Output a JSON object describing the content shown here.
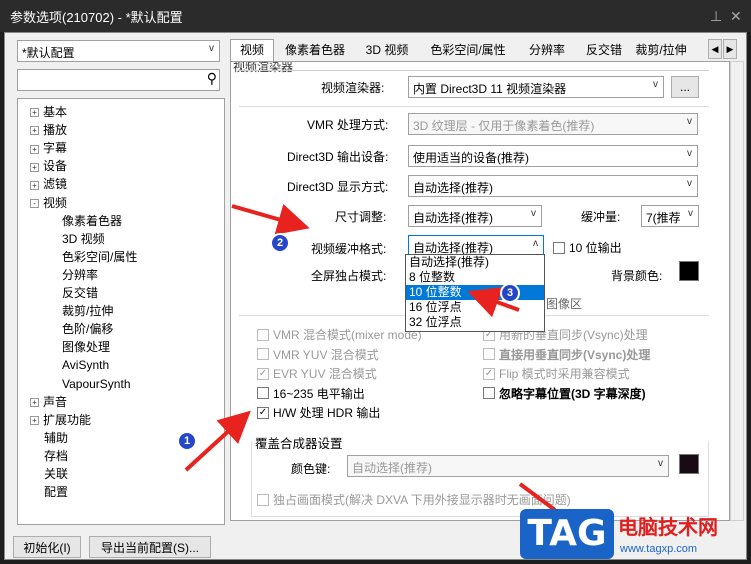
{
  "window": {
    "title": "参数选项(210702) - *默认配置",
    "pin_icon": "pin-icon",
    "close_icon": "close-icon"
  },
  "profile": {
    "selected": "*默认配置"
  },
  "search": {
    "value": ""
  },
  "tree": [
    {
      "label": "基本",
      "expand": "+"
    },
    {
      "label": "播放",
      "expand": "+"
    },
    {
      "label": "字幕",
      "expand": "+"
    },
    {
      "label": "设备",
      "expand": "+"
    },
    {
      "label": "滤镜",
      "expand": "+"
    },
    {
      "label": "视频",
      "expand": "-"
    },
    {
      "label": "像素着色器"
    },
    {
      "label": "3D 视频"
    },
    {
      "label": "色彩空间/属性"
    },
    {
      "label": "分辨率"
    },
    {
      "label": "反交错"
    },
    {
      "label": "裁剪/拉伸"
    },
    {
      "label": "色阶/偏移"
    },
    {
      "label": "图像处理"
    },
    {
      "label": "AviSynth"
    },
    {
      "label": "VapourSynth"
    },
    {
      "label": "声音",
      "expand": "+"
    },
    {
      "label": "扩展功能",
      "expand": "+"
    },
    {
      "label": "辅助"
    },
    {
      "label": "存档"
    },
    {
      "label": "关联"
    },
    {
      "label": "配置"
    }
  ],
  "tabs": [
    "视频",
    "像素着色器",
    "3D 视频",
    "色彩空间/属性",
    "分辨率",
    "反交错",
    "裁剪/拉伸"
  ],
  "panel": {
    "group_title": "视频渲染器",
    "renderer_label": "视频渲染器:",
    "renderer_value": "内置 Direct3D 11 视频渲染器",
    "renderer_more": "...",
    "vmr_label": "VMR 处理方式:",
    "vmr_value": "3D 纹理层 - 仅用于像素着色(推荐)",
    "d3d_device_label": "Direct3D 输出设备:",
    "d3d_device_value": "使用适当的设备(推荐)",
    "d3d_mode_label": "Direct3D 显示方式:",
    "d3d_mode_value": "自动选择(推荐)",
    "resize_label": "尺寸调整:",
    "resize_value": "自动选择(推荐)",
    "buffer_label": "缓冲量:",
    "buffer_value": "7(推荐",
    "bufferfmt_label": "视频缓冲格式:",
    "bufferfmt_value": "自动选择(推荐)",
    "tenbit_label": "10 位输出",
    "fullscreen_label": "全屏独占模式:",
    "bgcolor_label": "背景颜色:",
    "bgcolor": "#000000",
    "hidden_tail": "图像区",
    "dropdown": [
      "自动选择(推荐)",
      "8 位整数",
      "10 位整数",
      "16 位浮点",
      "32 位浮点"
    ],
    "dropdown_selected": 2,
    "checks_left": [
      {
        "label": "VMR 混合模式(mixer mode)",
        "checked": false,
        "disabled": true
      },
      {
        "label": "VMR YUV 混合模式",
        "checked": false,
        "disabled": true
      },
      {
        "label": "EVR YUV 混合模式",
        "checked": true,
        "disabled": true
      },
      {
        "label": "16~235 电平输出",
        "checked": false,
        "disabled": false
      },
      {
        "label": "H/W 处理 HDR 输出",
        "checked": true,
        "disabled": false
      }
    ],
    "checks_right": [
      {
        "label": "用新的垂直同步(Vsync)处理",
        "checked": true,
        "disabled": true,
        "bold": false
      },
      {
        "label": "直接用垂直同步(Vsync)处理",
        "checked": false,
        "disabled": true,
        "bold": true
      },
      {
        "label": "Flip 模式时采用兼容模式",
        "checked": true,
        "disabled": true,
        "bold": false
      },
      {
        "label": "忽略字幕位置(3D 字幕深度)",
        "checked": false,
        "disabled": false,
        "bold": true
      }
    ],
    "overlay_title": "覆盖合成器设置",
    "colorkey_label": "颜色键:",
    "colorkey_value": "自动选择(推荐)",
    "colorkey_color": "#1a0a14",
    "dxva_label": "独占画面模式(解决 DXVA 下用外接显示器时无画面问题)"
  },
  "buttons": {
    "init": "初始化(I)",
    "export": "导出当前配置(S)..."
  },
  "annotations": [
    "1",
    "2",
    "3"
  ],
  "watermark": {
    "logo": "TAG",
    "title": "电脑技术网",
    "url": "www.tagxp.com"
  }
}
